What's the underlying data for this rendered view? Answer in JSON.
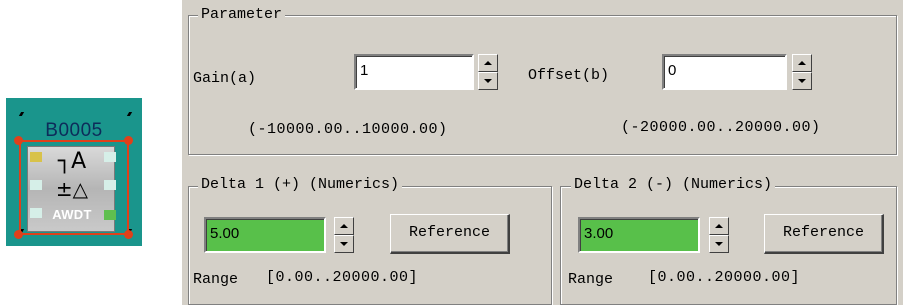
{
  "block": {
    "name": "B0005",
    "symbol_top": "┐A",
    "symbol_mid": "±△",
    "label": "AWDT",
    "colors": {
      "background": "#1a958c",
      "selection": "#e0401a",
      "pin_in": "#d8c24a",
      "pin_out": "#5fbf4f"
    }
  },
  "parameter": {
    "title": "Parameter",
    "gain": {
      "label": "Gain(a)",
      "value": "1",
      "range": "(-10000.00..10000.00)"
    },
    "offset": {
      "label": "Offset(b)",
      "value": "0",
      "range": "(-20000.00..20000.00)"
    }
  },
  "delta1": {
    "title": "Delta 1 (+)  (Numerics)",
    "value": "5.00",
    "reference_label": "Reference",
    "range_label": "Range",
    "range": "[0.00..20000.00]"
  },
  "delta2": {
    "title": "Delta 2 (-)  (Numerics)",
    "value": "3.00",
    "reference_label": "Reference",
    "range_label": "Range",
    "range": "[0.00..20000.00]"
  },
  "colors": {
    "panel": "#d4d0c8",
    "highlight_field": "#58c04a"
  }
}
